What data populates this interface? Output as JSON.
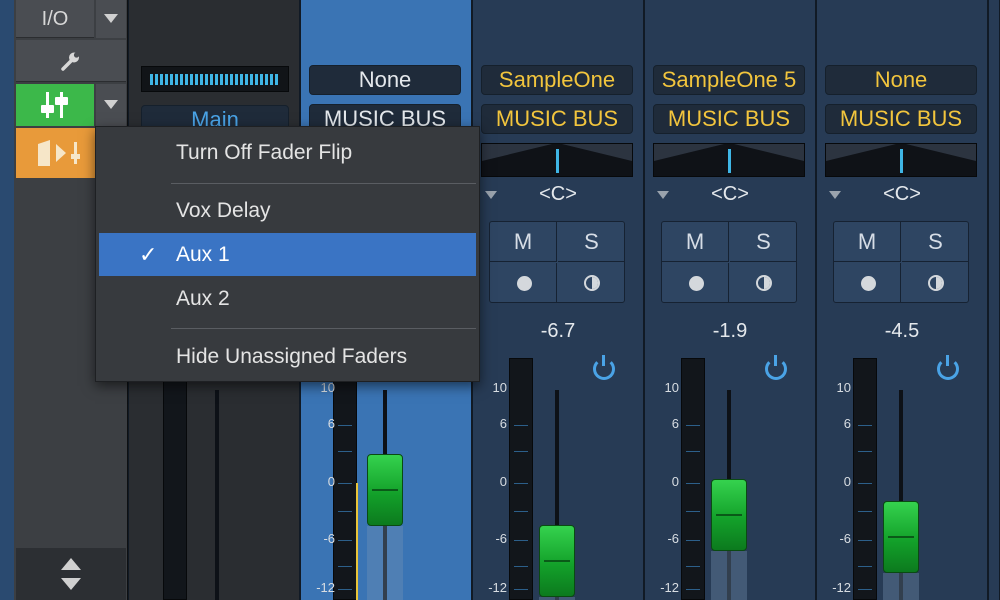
{
  "sidebar": {
    "io_label": "I/O",
    "icons": {
      "wrench": "wrench-icon",
      "fader_flip": "fader-flip-icon",
      "routing": "routing-icon",
      "scroll": "up-down-arrows-icon"
    },
    "colors": {
      "fader_flip": "#3cb84a",
      "routing": "#e89a3a"
    }
  },
  "channels": [
    {
      "id": "main",
      "input": "",
      "output": "Main"
    },
    {
      "id": "ch2",
      "input": "None",
      "output": "MUSIC BUS",
      "selected": true
    },
    {
      "id": "ch3",
      "input": "SampleOne",
      "output": "MUSIC BUS",
      "pan": "<C>",
      "mute": "M",
      "solo": "S",
      "volume": "-6.7",
      "fader_level": 0.34
    },
    {
      "id": "ch4",
      "input": "SampleOne 5",
      "output": "MUSIC BUS",
      "pan": "<C>",
      "mute": "M",
      "solo": "S",
      "volume": "-1.9",
      "fader_level": 0.55
    },
    {
      "id": "ch5",
      "input": "None",
      "output": "MUSIC BUS",
      "pan": "<C>",
      "mute": "M",
      "solo": "S",
      "volume": "-4.5",
      "fader_level": 0.45
    }
  ],
  "meter_scale": [
    "10",
    "6",
    "0",
    "-6",
    "-12"
  ],
  "menu": {
    "items": [
      {
        "label": "Turn Off Fader Flip",
        "checked": false
      },
      {
        "label": "Vox Delay",
        "checked": false
      },
      {
        "label": "Aux 1",
        "checked": true
      },
      {
        "label": "Aux 2",
        "checked": false
      },
      {
        "label": "Hide Unassigned Faders",
        "checked": false
      }
    ],
    "check_glyph": "✓"
  },
  "colors": {
    "channel": "#273b55",
    "selected_channel": "#3a74b4",
    "accent_yellow": "#f2c53d",
    "fader_green": "#1fbf3a",
    "highlight": "#3a74c4"
  }
}
